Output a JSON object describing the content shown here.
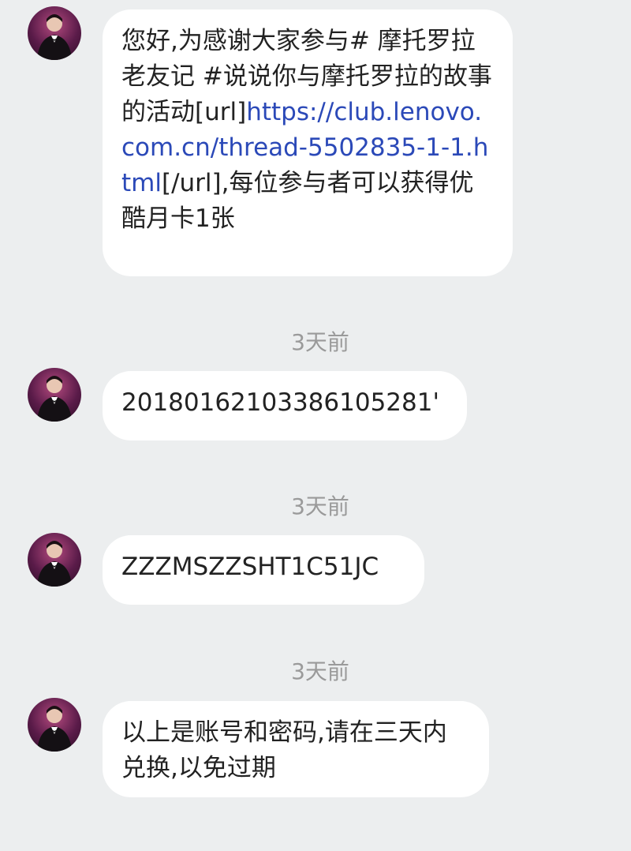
{
  "messages": [
    {
      "text_before_link": "您好,为感谢大家参与# 摩托罗拉老友记 #说说你与摩托罗拉的故事的活动[url]",
      "link": "https://club.lenovo.com.cn/thread-5502835-1-1.html",
      "text_after_link": "[/url],每位参与者可以获得优酷月卡1张"
    },
    {
      "timestamp": "3天前",
      "text": "20180162103386105281'"
    },
    {
      "timestamp": "3天前",
      "text": "ZZZMSZZSHT1C51JC"
    },
    {
      "timestamp": "3天前",
      "text": "以上是账号和密码,请在三天内兑换,以免过期"
    }
  ],
  "colors": {
    "background": "#eceeef",
    "bubble": "#ffffff",
    "link": "#2b49b8",
    "timestamp": "#9a9a9a"
  }
}
